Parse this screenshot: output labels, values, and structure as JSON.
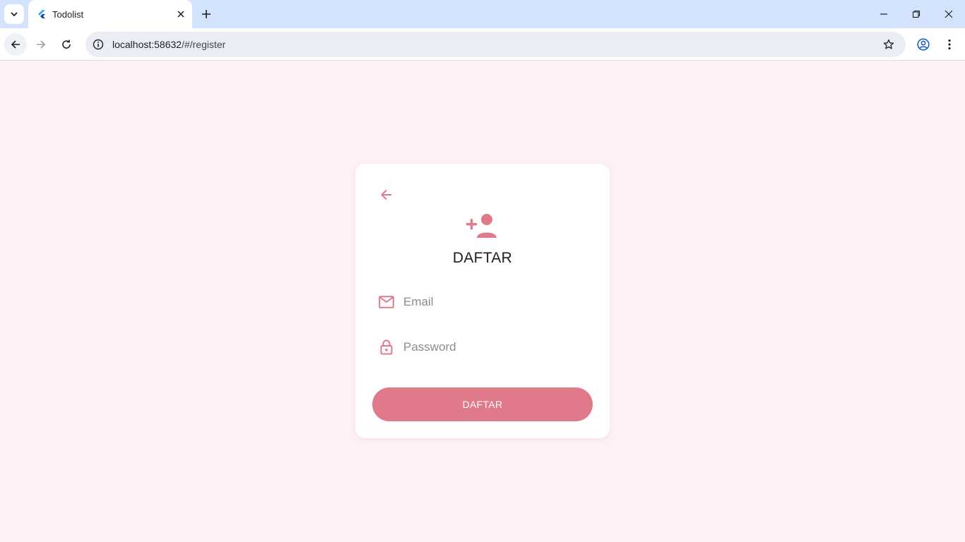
{
  "browser": {
    "tab_title": "Todolist",
    "url_host": "localhost:58632",
    "url_path": "/#/register"
  },
  "colors": {
    "accent": "#e07a8b",
    "page_background": "#fff0f3",
    "card_background": "#ffffff",
    "chrome_titlebar": "#d3e3fd"
  },
  "icons": {
    "back": "arrow-left-icon",
    "hero": "person-add-icon",
    "email": "mail-icon",
    "password": "lock-icon"
  },
  "register": {
    "title": "DAFTAR",
    "email_placeholder": "Email",
    "email_value": "",
    "password_placeholder": "Password",
    "password_value": "",
    "submit_label": "DAFTAR"
  }
}
